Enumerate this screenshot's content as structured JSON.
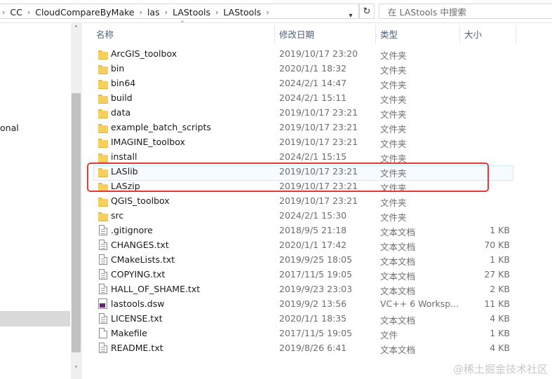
{
  "address": {
    "crumbs": [
      "CC",
      "CloudCompareByMake",
      "las",
      "LAStools",
      "LAStools"
    ],
    "dropdown_icon": "chevron-down-icon",
    "refresh_icon": "refresh-icon"
  },
  "search": {
    "placeholder": "在 LAStools 中搜索"
  },
  "nav": {
    "partial_label": "onal"
  },
  "columns": {
    "name": "名称",
    "date": "修改日期",
    "type": "类型",
    "size": "大小"
  },
  "files": [
    {
      "name": "ArcGIS_toolbox",
      "date": "2019/10/17 23:20",
      "type": "文件夹",
      "size": "",
      "kind": "folder"
    },
    {
      "name": "bin",
      "date": "2020/1/1 18:32",
      "type": "文件夹",
      "size": "",
      "kind": "folder"
    },
    {
      "name": "bin64",
      "date": "2024/2/1 14:47",
      "type": "文件夹",
      "size": "",
      "kind": "folder"
    },
    {
      "name": "build",
      "date": "2024/2/1 15:11",
      "type": "文件夹",
      "size": "",
      "kind": "folder"
    },
    {
      "name": "data",
      "date": "2019/10/17 23:21",
      "type": "文件夹",
      "size": "",
      "kind": "folder"
    },
    {
      "name": "example_batch_scripts",
      "date": "2019/10/17 23:21",
      "type": "文件夹",
      "size": "",
      "kind": "folder"
    },
    {
      "name": "IMAGINE_toolbox",
      "date": "2019/10/17 23:21",
      "type": "文件夹",
      "size": "",
      "kind": "folder"
    },
    {
      "name": "install",
      "date": "2024/2/1 15:15",
      "type": "文件夹",
      "size": "",
      "kind": "folder"
    },
    {
      "name": "LASlib",
      "date": "2019/10/17 23:21",
      "type": "文件夹",
      "size": "",
      "kind": "folder"
    },
    {
      "name": "LASzip",
      "date": "2019/10/17 23:21",
      "type": "文件夹",
      "size": "",
      "kind": "folder"
    },
    {
      "name": "QGIS_toolbox",
      "date": "2019/10/17 23:21",
      "type": "文件夹",
      "size": "",
      "kind": "folder"
    },
    {
      "name": "src",
      "date": "2024/2/1 15:30",
      "type": "文件夹",
      "size": "",
      "kind": "folder"
    },
    {
      "name": ".gitignore",
      "date": "2018/9/5 21:18",
      "type": "文本文档",
      "size": "1 KB",
      "kind": "file"
    },
    {
      "name": "CHANGES.txt",
      "date": "2020/1/1 17:42",
      "type": "文本文档",
      "size": "70 KB",
      "kind": "file"
    },
    {
      "name": "CMakeLists.txt",
      "date": "2019/9/25 18:05",
      "type": "文本文档",
      "size": "1 KB",
      "kind": "file"
    },
    {
      "name": "COPYING.txt",
      "date": "2017/11/5 19:05",
      "type": "文本文档",
      "size": "27 KB",
      "kind": "file"
    },
    {
      "name": "HALL_OF_SHAME.txt",
      "date": "2019/9/23 23:03",
      "type": "文本文档",
      "size": "2 KB",
      "kind": "file"
    },
    {
      "name": "lastools.dsw",
      "date": "2019/9/2 13:56",
      "type": "VC++ 6 Worksp...",
      "size": "11 KB",
      "kind": "vs"
    },
    {
      "name": "LICENSE.txt",
      "date": "2020/1/1 18:35",
      "type": "文本文档",
      "size": "4 KB",
      "kind": "file"
    },
    {
      "name": "Makefile",
      "date": "2017/11/5 19:05",
      "type": "文件",
      "size": "1 KB",
      "kind": "plain"
    },
    {
      "name": "README.txt",
      "date": "2019/8/26 6:41",
      "type": "文本文档",
      "size": "4 KB",
      "kind": "file"
    }
  ],
  "watermark": "@稀土掘金技术社区",
  "colors": {
    "highlight": "#e53935",
    "folder": "#f7cf5c",
    "header_text": "#4c607a"
  }
}
